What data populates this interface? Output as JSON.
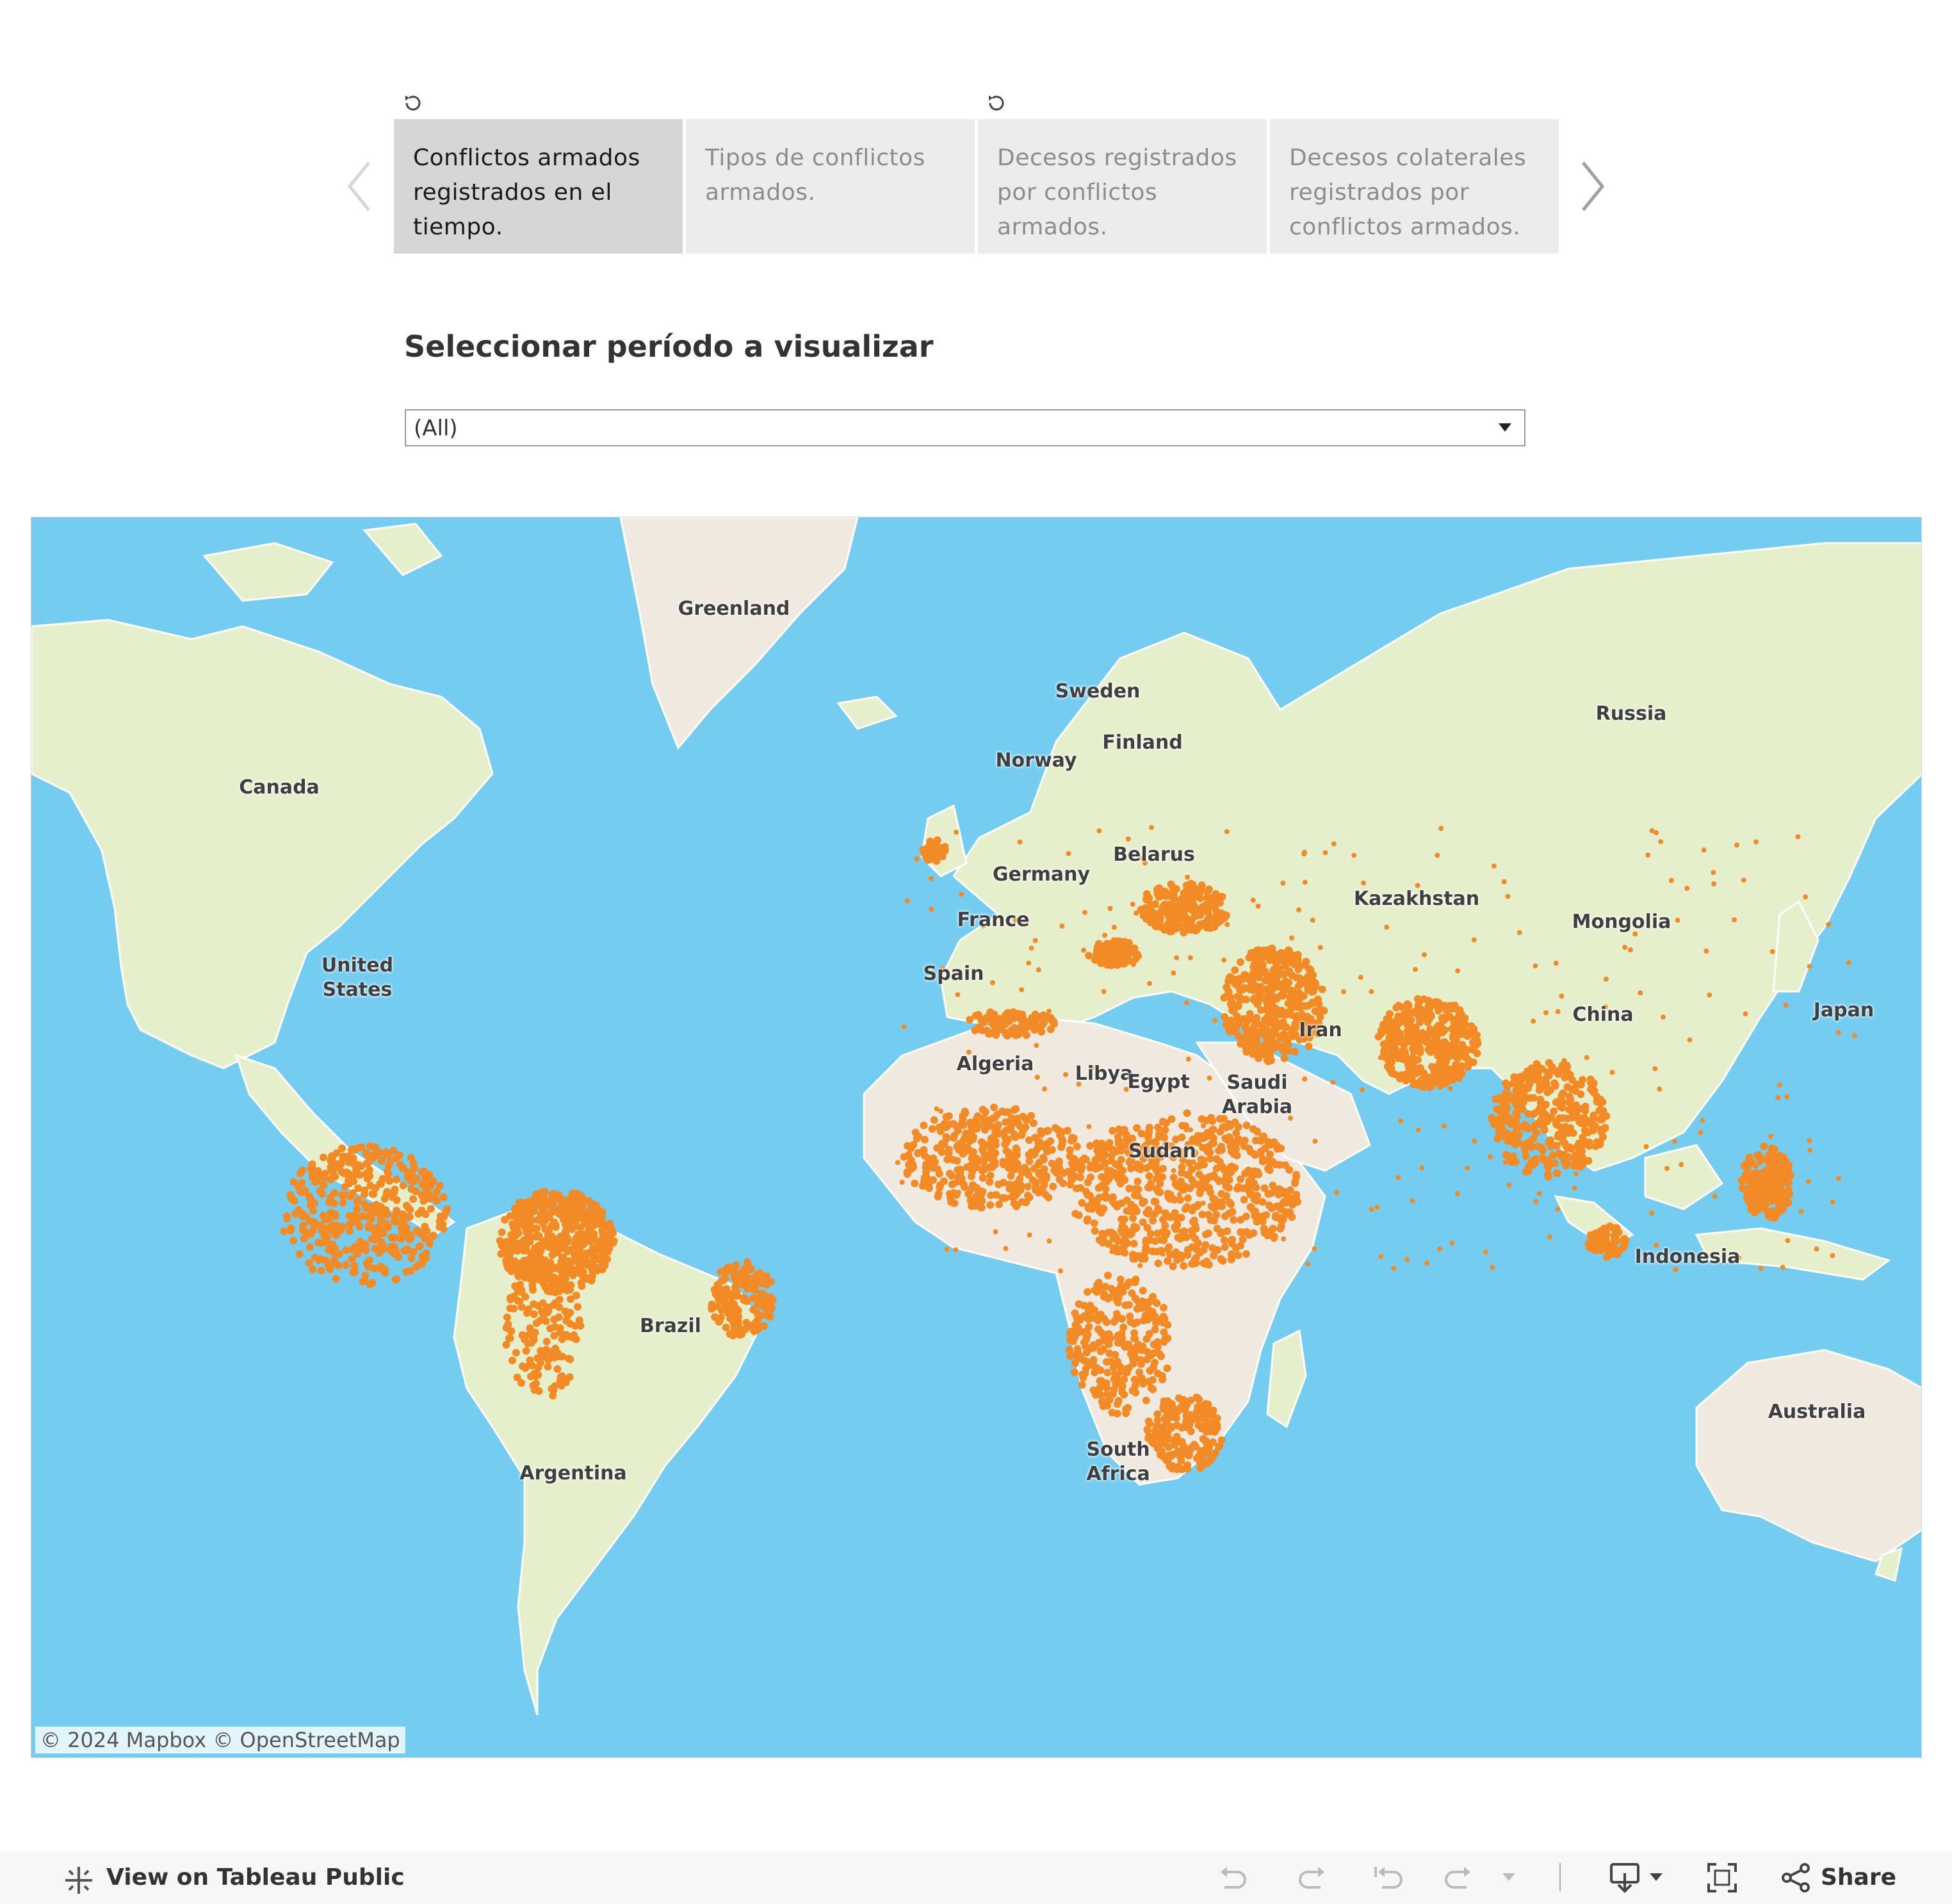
{
  "story": {
    "points": [
      {
        "label": "Conflictos armados registrados en el tiempo.",
        "active": true
      },
      {
        "label": "Tipos de conflictos armados.",
        "active": false
      },
      {
        "label": "Decesos registrados por conflictos armados.",
        "active": false
      },
      {
        "label": "Decesos colaterales registrados por conflictos armados.",
        "active": false
      }
    ]
  },
  "filter": {
    "title": "Seleccionar período a visualizar",
    "selected": "(All)"
  },
  "map": {
    "countries": [
      {
        "name": "Greenland"
      },
      {
        "name": "Canada"
      },
      {
        "name": "United\nStates"
      },
      {
        "name": "Sweden"
      },
      {
        "name": "Norway"
      },
      {
        "name": "Finland"
      },
      {
        "name": "Russia"
      },
      {
        "name": "Belarus"
      },
      {
        "name": "Germany"
      },
      {
        "name": "France"
      },
      {
        "name": "Kazakhstan"
      },
      {
        "name": "Mongolia"
      },
      {
        "name": "Spain"
      },
      {
        "name": "Iran"
      },
      {
        "name": "China"
      },
      {
        "name": "Japan"
      },
      {
        "name": "Algeria"
      },
      {
        "name": "Libya"
      },
      {
        "name": "Egypt"
      },
      {
        "name": "Saudi\nArabia"
      },
      {
        "name": "Sudan"
      },
      {
        "name": "Brazil"
      },
      {
        "name": "Indonesia"
      },
      {
        "name": "Australia"
      },
      {
        "name": "Argentina"
      },
      {
        "name": "South\nAfrica"
      }
    ],
    "attribution": "© 2024 Mapbox  © OpenStreetMap",
    "colors": {
      "water": "#74cdf0",
      "land": "#e6efcb",
      "desert": "#efe9df",
      "points": "#f28b26"
    }
  },
  "toolbar": {
    "view_label": "View on Tableau Public",
    "share_label": "Share"
  }
}
